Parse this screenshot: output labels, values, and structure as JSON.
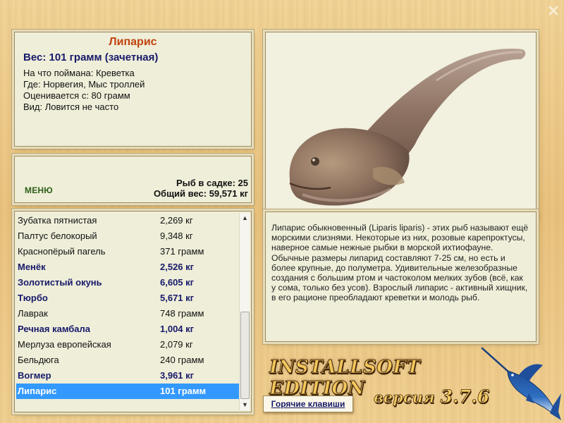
{
  "fish": {
    "name": "Липарис",
    "weight_line": "Вес: 101 грамм (зачетная)",
    "info": [
      "На что поймана: Креветка",
      "Где: Норвегия, Мыс троллей",
      "Оценивается с: 80 грамм",
      "Вид: Ловится не часто"
    ]
  },
  "menu_label": "МЕНЮ",
  "stats": {
    "count_line": "Рыб в садке: 25",
    "total_line": "Общий вес: 59,571 кг"
  },
  "catch_list": [
    {
      "name": "Зубатка пятнистая",
      "weight": "2,269 кг",
      "style": "normal"
    },
    {
      "name": "Палтус белокорый",
      "weight": "9,348 кг",
      "style": "normal"
    },
    {
      "name": "Краснопёрый пагель",
      "weight": "371 грамм",
      "style": "normal"
    },
    {
      "name": "Менёк",
      "weight": "2,526 кг",
      "style": "bold"
    },
    {
      "name": "Золотистый окунь",
      "weight": "6,605 кг",
      "style": "bold"
    },
    {
      "name": "Тюрбо",
      "weight": "5,671 кг",
      "style": "bold"
    },
    {
      "name": "Лаврак",
      "weight": "748 грамм",
      "style": "normal"
    },
    {
      "name": "Речная камбала",
      "weight": "1,004 кг",
      "style": "bold"
    },
    {
      "name": "Мерлуза европейская",
      "weight": "2,079 кг",
      "style": "normal"
    },
    {
      "name": "Бельдюга",
      "weight": "240 грамм",
      "style": "normal"
    },
    {
      "name": "Вогмер",
      "weight": "3,961 кг",
      "style": "bold"
    },
    {
      "name": "Липарис",
      "weight": "101 грамм",
      "style": "selected"
    }
  ],
  "description": "Липарис обыкновенный (Liparis liparis) - этих рыб называют ещё морскими слизнями. Некоторые из них, розовые карепроктусы, наверное самые нежные рыбки в морской ихтиофауне. Обычные размеры липарид составляют 7-25 см, но есть и более крупные, до полуметра. Удивительные железобразные создания с большим ртом и частоколом мелких зубов (всё, как у сома, только без усов). Взрослый липарис - активный хищник, в его рационе преобладают креветки и молодь рыб.",
  "hotkeys_label": "Горячие клавиши",
  "brand": {
    "title": "INSTALLSOFT EDITION",
    "version_word": "версия",
    "version_number": "3.7.6"
  },
  "colors": {
    "accent_title": "#c1440e",
    "highlight_text": "#16196a",
    "selection": "#3399ff",
    "menu": "#2e5f1a"
  },
  "icons": [
    "close-icon",
    "marlin-icon",
    "fish-photo"
  ]
}
